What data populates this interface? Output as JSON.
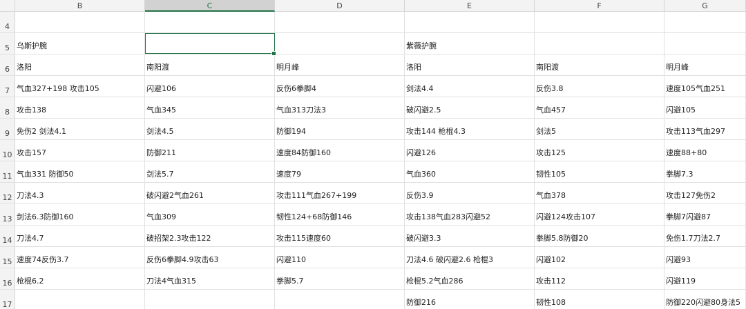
{
  "columns": [
    "B",
    "C",
    "D",
    "E",
    "F",
    "G"
  ],
  "selected_column": "C",
  "rows": [
    {
      "num": "4",
      "cells": [
        "",
        "",
        "",
        "",
        "",
        ""
      ]
    },
    {
      "num": "5",
      "cells": [
        "乌斯护腕",
        "",
        "",
        "紫薇护腕",
        "",
        ""
      ]
    },
    {
      "num": "6",
      "cells": [
        "洛阳",
        "南阳渡",
        "明月峰",
        "洛阳",
        "南阳渡",
        "明月峰"
      ]
    },
    {
      "num": "7",
      "cells": [
        "气血327+198 攻击105",
        "闪避106",
        "反伤6拳脚4",
        "剑法4.4",
        "反伤3.8",
        "速度105气血251"
      ]
    },
    {
      "num": "8",
      "cells": [
        "攻击138",
        "气血345",
        "气血313刀法3",
        "破闪避2.5",
        "气血457",
        "闪避105"
      ]
    },
    {
      "num": "9",
      "cells": [
        "免伤2  剑法4.1",
        "剑法4.5",
        "防御194",
        "攻击144 枪棍4.3",
        "剑法5",
        "攻击113气血297"
      ]
    },
    {
      "num": "10",
      "cells": [
        "攻击157",
        "防御211",
        "速度84防御160",
        "闪避126",
        "攻击125",
        "速度88+80"
      ]
    },
    {
      "num": "11",
      "cells": [
        "气血331  防御50",
        "剑法5.7",
        "速度79",
        "气血360",
        "韧性105",
        "拳脚7.3"
      ]
    },
    {
      "num": "12",
      "cells": [
        "刀法4.3",
        "破闪避2气血261",
        "攻击111气血267+199",
        "反伤3.9",
        "气血378",
        "攻击127免伤2"
      ]
    },
    {
      "num": "13",
      "cells": [
        "剑法6.3防御160",
        "气血309",
        "韧性124+68防御146",
        "攻击138气血283闪避52",
        "闪避124攻击107",
        "拳脚7闪避87"
      ]
    },
    {
      "num": "14",
      "cells": [
        "刀法4.7",
        "破招架2.3攻击122",
        "攻击115速度60",
        "破闪避3.3",
        "拳脚5.8防御20",
        "免伤1.7刀法2.7"
      ]
    },
    {
      "num": "15",
      "cells": [
        "速度74反伤3.7",
        "反伤6拳脚4.9攻击63",
        "闪避110",
        "刀法4.6 破闪避2.6 枪棍3",
        "闪避102",
        "闪避93"
      ]
    },
    {
      "num": "16",
      "cells": [
        "枪棍6.2",
        "刀法4气血315",
        "拳脚5.7",
        "枪棍5.2气血286",
        "攻击112",
        "闪避119"
      ]
    },
    {
      "num": "17",
      "cells": [
        "",
        "",
        "",
        "防御216",
        "韧性108",
        "防御220闪避80身法5"
      ]
    }
  ]
}
